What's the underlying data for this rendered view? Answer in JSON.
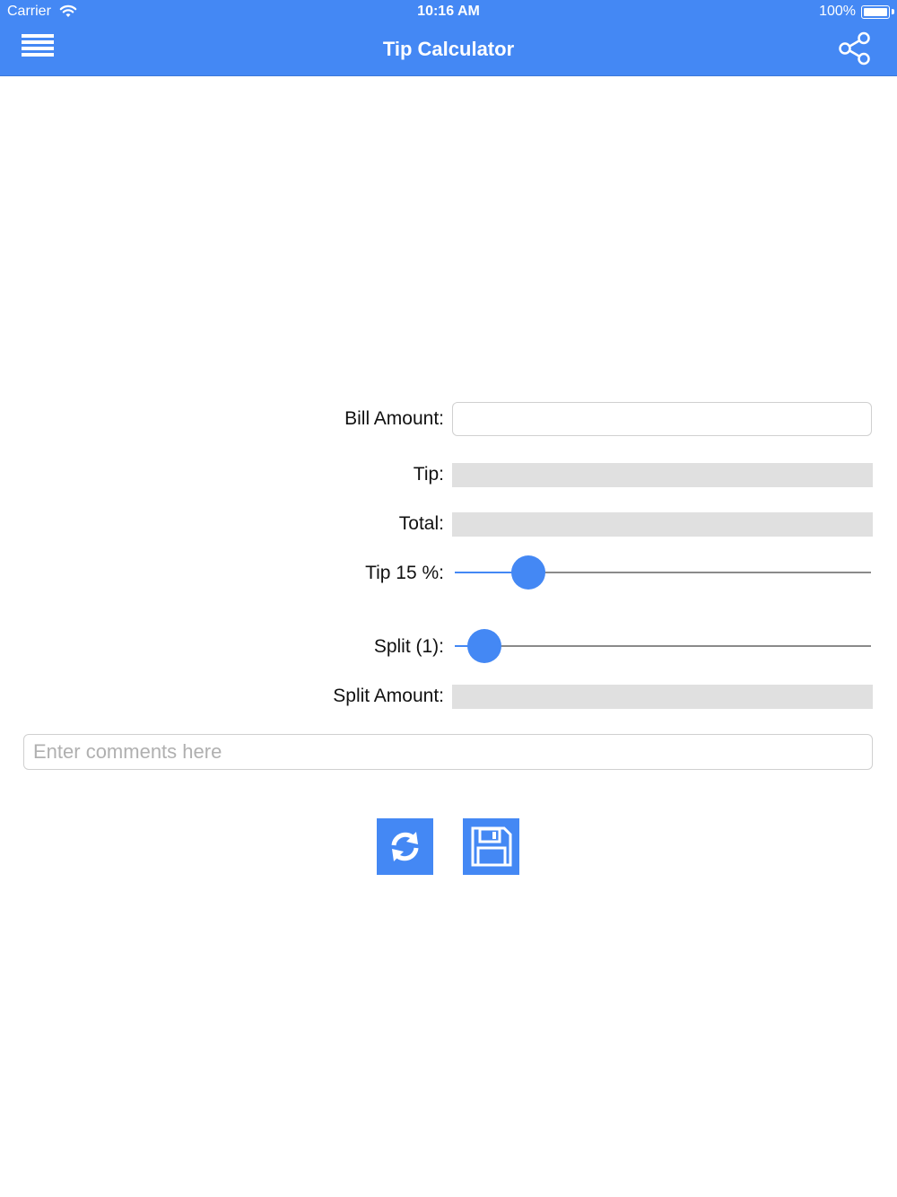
{
  "status_bar": {
    "carrier": "Carrier",
    "time": "10:16 AM",
    "battery": "100%"
  },
  "header": {
    "title": "Tip  Calculator",
    "menu_icon": "hamburger-menu-icon",
    "share_icon": "share-icon",
    "color": "#4488f4"
  },
  "form": {
    "bill_amount_label": "Bill Amount:",
    "bill_amount_value": "",
    "tip_label": "Tip:",
    "tip_value": "",
    "total_label": "Total:",
    "total_value": "",
    "tip_percent_label": "Tip 15 %:",
    "tip_percent_slider_fraction": 0.177,
    "split_label": "Split (1):",
    "split_slider_fraction": 0.072,
    "split_amount_label": "Split Amount:",
    "split_amount_value": "",
    "comments_placeholder": "Enter comments here"
  },
  "actions": {
    "refresh_icon": "refresh-icon",
    "save_icon": "save-floppy-icon"
  }
}
